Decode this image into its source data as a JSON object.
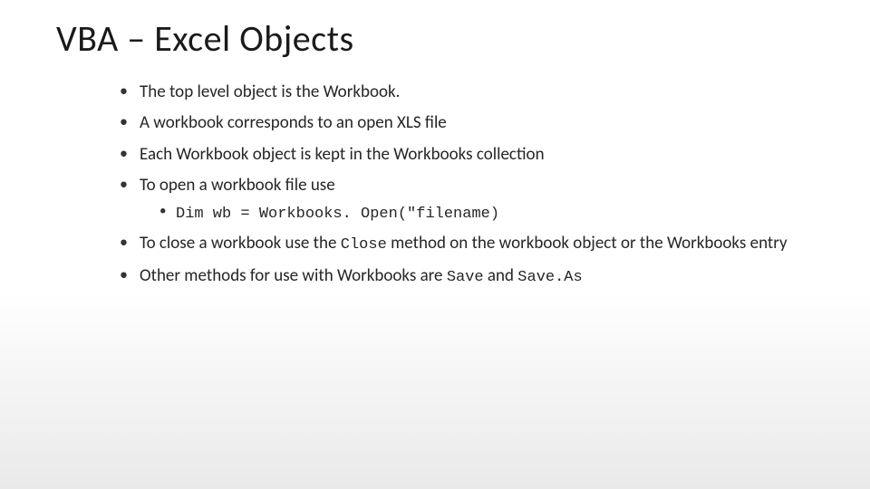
{
  "title": "VBA – Excel Objects",
  "bullets": {
    "b1": "The top level object is the Workbook.",
    "b2": "A workbook corresponds to an open XLS file",
    "b3": "Each Workbook object is kept in the Workbooks collection",
    "b4": "To open a workbook file use",
    "b4_sub_prefix": "Dim wb = Workbooks. Open(\"filename)",
    "b5_pre": "To close a workbook use the ",
    "b5_code": "Close",
    "b5_post": " method on the workbook object or the Workbooks entry",
    "b6_pre": "Other methods for use with Workbooks are ",
    "b6_code1": "Save",
    "b6_mid": " and ",
    "b6_code2": "Save.As"
  }
}
